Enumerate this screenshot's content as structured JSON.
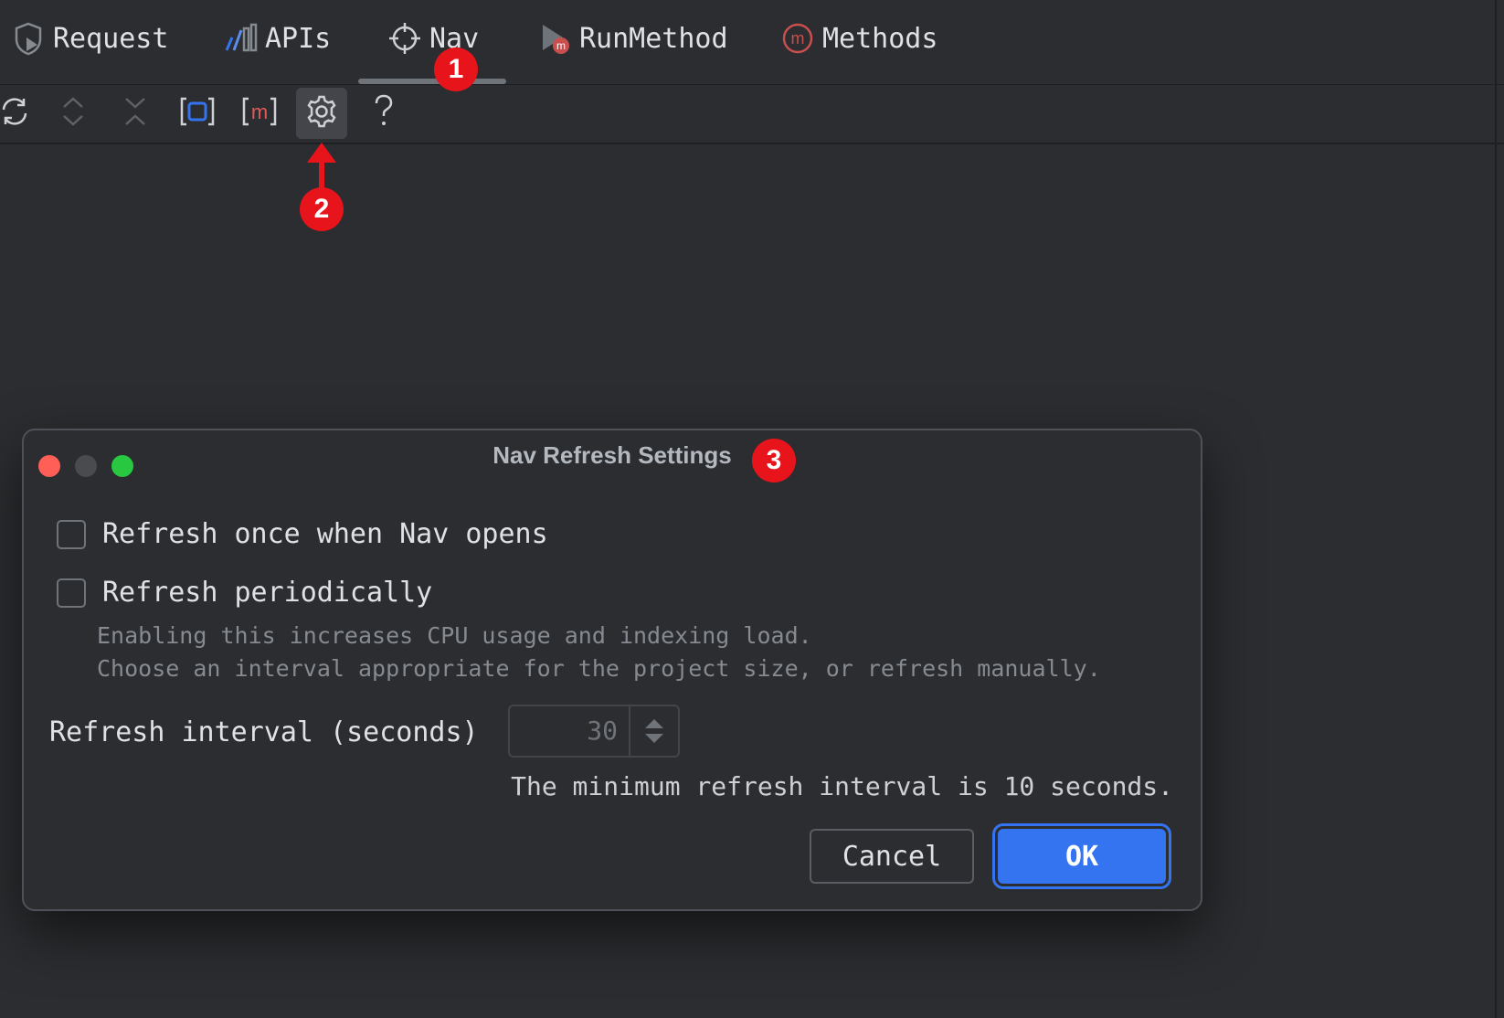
{
  "tabs": [
    {
      "label": "Request",
      "icon": "request-shield-icon"
    },
    {
      "label": "APIs",
      "icon": "apis-bars-icon"
    },
    {
      "label": "Nav",
      "icon": "crosshair-icon",
      "active": true
    },
    {
      "label": "RunMethod",
      "icon": "run-method-icon"
    },
    {
      "label": "Methods",
      "icon": "methods-m-icon"
    }
  ],
  "toolbar": {
    "buttons": [
      {
        "name": "refresh-icon"
      },
      {
        "name": "expand-icon"
      },
      {
        "name": "collapse-icon"
      },
      {
        "name": "select-frame-icon"
      },
      {
        "name": "method-m-icon"
      },
      {
        "name": "gear-icon",
        "active": true
      },
      {
        "name": "help-icon"
      }
    ]
  },
  "annotations": {
    "badge1": "1",
    "badge2": "2",
    "badge3": "3"
  },
  "dialog": {
    "title": "Nav Refresh Settings",
    "refresh_once_label": "Refresh once when Nav opens",
    "refresh_once_checked": false,
    "refresh_periodic_label": "Refresh periodically",
    "refresh_periodic_checked": false,
    "hint_line1": "Enabling this increases CPU usage and indexing load.",
    "hint_line2": "Choose an interval appropriate for the project size, or refresh manually.",
    "interval_label": "Refresh interval (seconds)",
    "interval_value": "30",
    "min_note": "The minimum refresh interval is 10 seconds.",
    "cancel_label": "Cancel",
    "ok_label": "OK"
  },
  "colors": {
    "background": "#2b2d30",
    "accent": "#3574f0",
    "badge": "#e8141b",
    "traffic_close": "#ff5f57",
    "traffic_min": "#4a4b4f",
    "traffic_max": "#28c840"
  }
}
